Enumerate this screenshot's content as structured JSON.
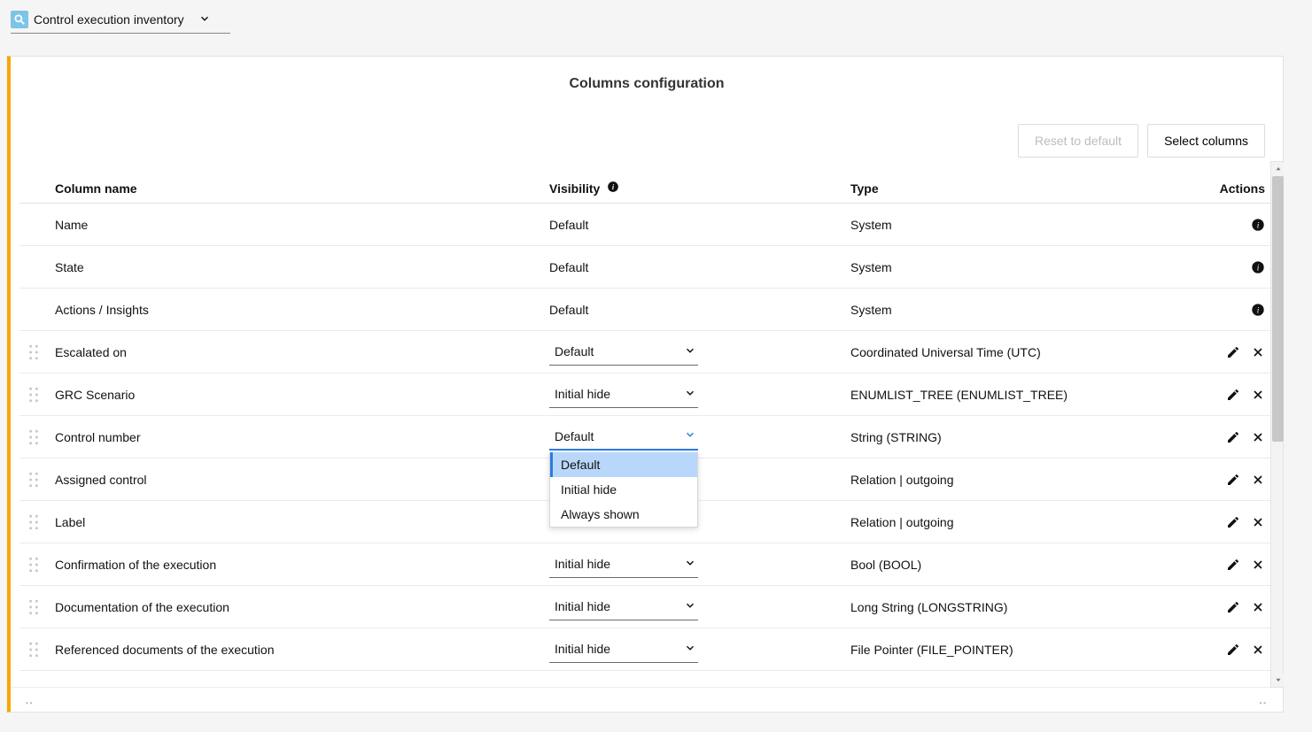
{
  "breadcrumb": {
    "label": "Control execution inventory"
  },
  "panel": {
    "title": "Columns configuration",
    "buttons": {
      "reset": "Reset to default",
      "select_columns": "Select columns"
    },
    "columns": {
      "name": "Column name",
      "visibility": "Visibility",
      "type": "Type",
      "actions": "Actions"
    }
  },
  "visibility_options": [
    "Default",
    "Initial hide",
    "Always shown"
  ],
  "rows": [
    {
      "name": "Name",
      "visibility": "Default",
      "visibility_editable": false,
      "type": "System",
      "draggable": false,
      "action_kind": "info"
    },
    {
      "name": "State",
      "visibility": "Default",
      "visibility_editable": false,
      "type": "System",
      "draggable": false,
      "action_kind": "info"
    },
    {
      "name": "Actions / Insights",
      "visibility": "Default",
      "visibility_editable": false,
      "type": "System",
      "draggable": false,
      "action_kind": "info"
    },
    {
      "name": "Escalated on",
      "visibility": "Default",
      "visibility_editable": true,
      "type": "Coordinated Universal Time (UTC)",
      "draggable": true,
      "action_kind": "edit_delete"
    },
    {
      "name": "GRC Scenario",
      "visibility": "Initial hide",
      "visibility_editable": true,
      "type": "ENUMLIST_TREE (ENUMLIST_TREE)",
      "draggable": true,
      "action_kind": "edit_delete"
    },
    {
      "name": "Control number",
      "visibility": "Default",
      "visibility_editable": true,
      "type": "String (STRING)",
      "draggable": true,
      "action_kind": "edit_delete",
      "dropdown_open": true
    },
    {
      "name": "Assigned control",
      "visibility": "",
      "visibility_editable": true,
      "visibility_hidden_by_dropdown": true,
      "type": "Relation | outgoing",
      "draggable": true,
      "action_kind": "edit_delete"
    },
    {
      "name": "Label",
      "visibility": "",
      "visibility_editable": true,
      "visibility_hidden_by_dropdown": true,
      "type": "Relation | outgoing",
      "draggable": true,
      "action_kind": "edit_delete"
    },
    {
      "name": "Confirmation of the execution",
      "visibility": "Initial hide",
      "visibility_editable": true,
      "type": "Bool (BOOL)",
      "draggable": true,
      "action_kind": "edit_delete"
    },
    {
      "name": "Documentation of the execution",
      "visibility": "Initial hide",
      "visibility_editable": true,
      "type": "Long String (LONGSTRING)",
      "draggable": true,
      "action_kind": "edit_delete"
    },
    {
      "name": "Referenced documents of the execution",
      "visibility": "Initial hide",
      "visibility_editable": true,
      "type": "File Pointer (FILE_POINTER)",
      "draggable": true,
      "action_kind": "edit_delete"
    }
  ]
}
